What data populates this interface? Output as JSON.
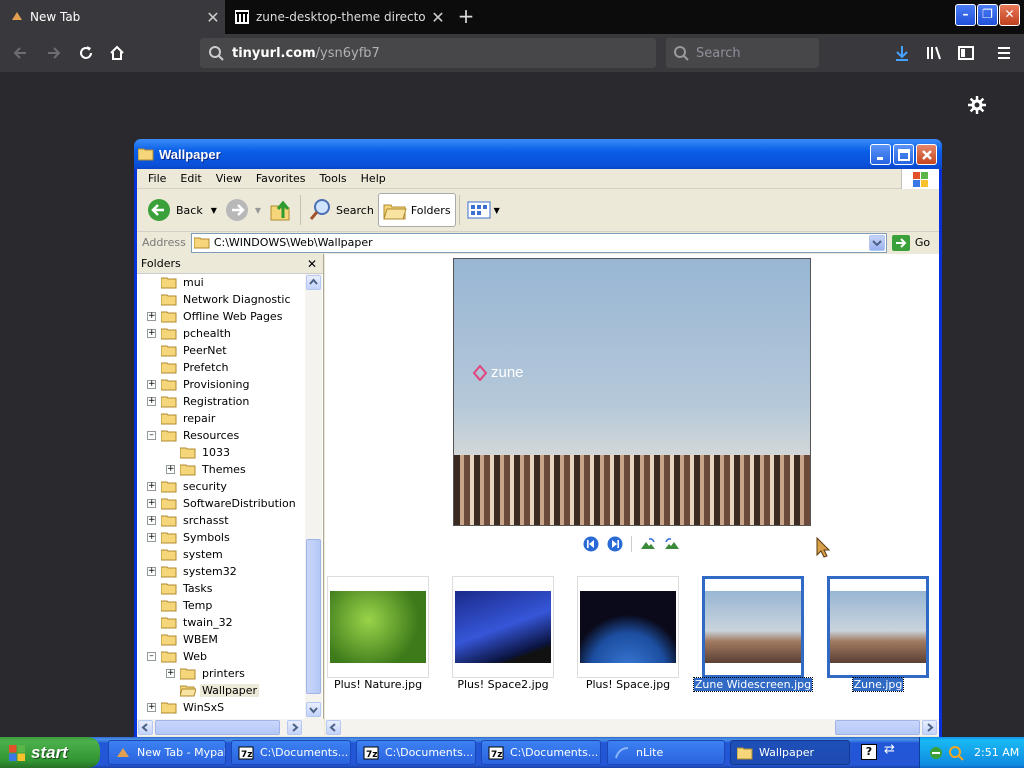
{
  "browser": {
    "tabs": [
      {
        "label": "New Tab"
      },
      {
        "label": "zune-desktop-theme directory lis"
      }
    ],
    "url_host": "tinyurl.com",
    "url_path": "/ysn6yfb7",
    "search_placeholder": "Search"
  },
  "explorer": {
    "title": "Wallpaper",
    "menu": [
      "File",
      "Edit",
      "View",
      "Favorites",
      "Tools",
      "Help"
    ],
    "toolbar": {
      "back": "Back",
      "search": "Search",
      "folders": "Folders"
    },
    "address_label": "Address",
    "address_value": "C:\\WINDOWS\\Web\\Wallpaper",
    "go_label": "Go",
    "folders_title": "Folders",
    "tree": [
      {
        "label": "mui",
        "level": 1,
        "expander": ""
      },
      {
        "label": "Network Diagnostic",
        "level": 1,
        "expander": ""
      },
      {
        "label": "Offline Web Pages",
        "level": 1,
        "expander": "+"
      },
      {
        "label": "pchealth",
        "level": 1,
        "expander": "+"
      },
      {
        "label": "PeerNet",
        "level": 1,
        "expander": ""
      },
      {
        "label": "Prefetch",
        "level": 1,
        "expander": ""
      },
      {
        "label": "Provisioning",
        "level": 1,
        "expander": "+"
      },
      {
        "label": "Registration",
        "level": 1,
        "expander": "+"
      },
      {
        "label": "repair",
        "level": 1,
        "expander": ""
      },
      {
        "label": "Resources",
        "level": 1,
        "expander": "-"
      },
      {
        "label": "1033",
        "level": 2,
        "expander": ""
      },
      {
        "label": "Themes",
        "level": 2,
        "expander": "+"
      },
      {
        "label": "security",
        "level": 1,
        "expander": "+"
      },
      {
        "label": "SoftwareDistribution",
        "level": 1,
        "expander": "+"
      },
      {
        "label": "srchasst",
        "level": 1,
        "expander": "+"
      },
      {
        "label": "Symbols",
        "level": 1,
        "expander": "+"
      },
      {
        "label": "system",
        "level": 1,
        "expander": ""
      },
      {
        "label": "system32",
        "level": 1,
        "expander": "+"
      },
      {
        "label": "Tasks",
        "level": 1,
        "expander": ""
      },
      {
        "label": "Temp",
        "level": 1,
        "expander": ""
      },
      {
        "label": "twain_32",
        "level": 1,
        "expander": ""
      },
      {
        "label": "WBEM",
        "level": 1,
        "expander": ""
      },
      {
        "label": "Web",
        "level": 1,
        "expander": "-"
      },
      {
        "label": "printers",
        "level": 2,
        "expander": "+"
      },
      {
        "label": "Wallpaper",
        "level": 2,
        "expander": "",
        "selected": true
      },
      {
        "label": "WinSxS",
        "level": 1,
        "expander": "+"
      }
    ],
    "preview_logo": "zune",
    "thumbnails": [
      {
        "label": "Plus! Nature.jpg",
        "selected": false
      },
      {
        "label": "Plus! Space2.jpg",
        "selected": false
      },
      {
        "label": "Plus! Space.jpg",
        "selected": false
      },
      {
        "label": "Zune Widescreen.jpg",
        "selected": true
      },
      {
        "label": "Zune.jpg",
        "selected": true
      }
    ]
  },
  "taskbar": {
    "start_label": "start",
    "items": [
      {
        "label": "New Tab - Mypal"
      },
      {
        "label": "C:\\Documents..."
      },
      {
        "label": "C:\\Documents..."
      },
      {
        "label": "C:\\Documents..."
      },
      {
        "label": "nLite"
      },
      {
        "label": "Wallpaper",
        "active": true
      }
    ],
    "clock": "2:51 AM"
  },
  "colors": {
    "xp_blue": "#0831d9",
    "selection": "#316ac5",
    "start_green": "#3c9a3c",
    "firefox_dark": "#38383d"
  }
}
